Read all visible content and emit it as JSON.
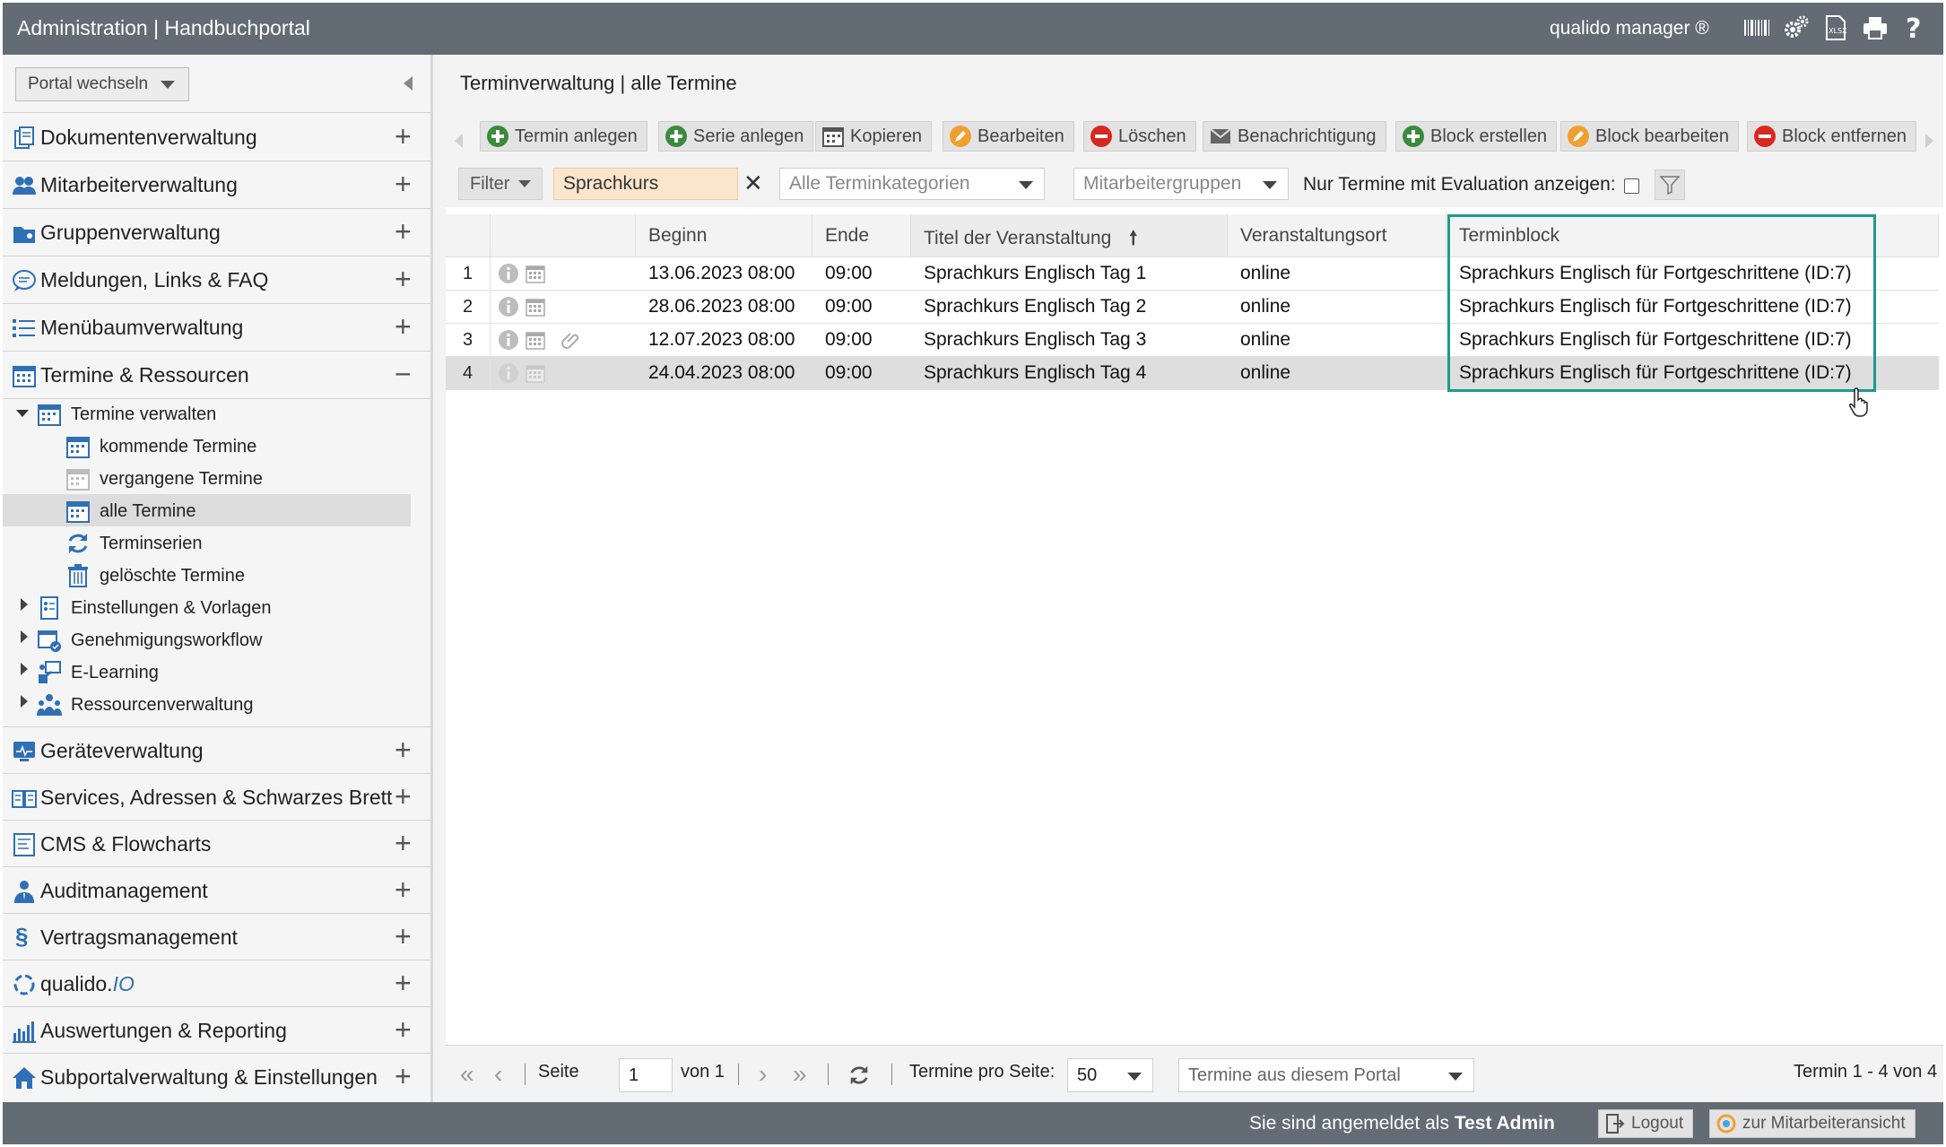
{
  "header": {
    "title": "Administration | Handbuchportal",
    "brand": "qualido manager ®",
    "icons": [
      "barcode-icon",
      "gears-icon",
      "xlsx-export-icon",
      "print-icon",
      "help-icon"
    ]
  },
  "sidebar": {
    "portal_switch": "Portal wechseln",
    "sections": [
      {
        "label": "Dokumentenverwaltung",
        "icon": "documents-icon",
        "state": "+"
      },
      {
        "label": "Mitarbeiterverwaltung",
        "icon": "users-icon",
        "state": "+"
      },
      {
        "label": "Gruppenverwaltung",
        "icon": "group-folder-icon",
        "state": "+"
      },
      {
        "label": "Meldungen, Links & FAQ",
        "icon": "speech-bubble-icon",
        "state": "+"
      },
      {
        "label": "Menübaumverwaltung",
        "icon": "list-tree-icon",
        "state": "+"
      },
      {
        "label": "Termine & Ressourcen",
        "icon": "calendar-icon",
        "state": "−"
      }
    ],
    "tree": {
      "termine_verwalten": "Termine verwalten",
      "kommende": "kommende Termine",
      "vergangene": "vergangene Termine",
      "alle": "alle Termine",
      "serien": "Terminserien",
      "geloescht": "gelöschte Termine",
      "einstellungen": "Einstellungen & Vorlagen",
      "genehmigung": "Genehmigungsworkflow",
      "elearning": "E-Learning",
      "ressourcen": "Ressourcenverwaltung"
    },
    "sections2": [
      {
        "label": "Geräteverwaltung",
        "icon": "device-monitor-icon",
        "state": "+"
      },
      {
        "label": "Services, Adressen & Schwarzes Brett",
        "icon": "address-book-icon",
        "state": "+"
      },
      {
        "label": "CMS & Flowcharts",
        "icon": "cms-icon",
        "state": "+"
      },
      {
        "label": "Auditmanagement",
        "icon": "auditor-icon",
        "state": "+"
      },
      {
        "label": "Vertragsmanagement",
        "icon": "paragraph-icon",
        "state": "+"
      },
      {
        "label": "qualido.",
        "label_suffix": "IO",
        "icon": "qualido-io-icon",
        "state": "+"
      },
      {
        "label": "Auswertungen & Reporting",
        "icon": "bar-chart-icon",
        "state": "+"
      },
      {
        "label": "Subportalverwaltung & Einstellungen",
        "icon": "home-icon",
        "state": "+"
      }
    ]
  },
  "main": {
    "breadcrumb": "Terminverwaltung | alle Termine",
    "toolbar": {
      "termin_anlegen": "Termin anlegen",
      "serie_anlegen": "Serie anlegen",
      "kopieren": "Kopieren",
      "bearbeiten": "Bearbeiten",
      "loeschen": "Löschen",
      "benachrichtigung": "Benachrichtigung",
      "block_erstellen": "Block erstellen",
      "block_bearbeiten": "Block bearbeiten",
      "block_entfernen": "Block entfernen"
    },
    "filter": {
      "filter_label": "Filter",
      "search_value": "Sprachkurs",
      "kategorien": "Alle Terminkategorien",
      "gruppen": "Mitarbeitergruppen",
      "evaluation_label": "Nur Termine mit Evaluation anzeigen:",
      "evaluation_checked": false
    },
    "grid": {
      "columns": [
        "Beginn",
        "Ende",
        "Titel der Veranstaltung",
        "Veranstaltungsort",
        "Terminblock"
      ],
      "sort_indicator": "🠕",
      "rows": [
        {
          "num": "1",
          "beginn": "13.06.2023 08:00",
          "ende": "09:00",
          "titel": "Sprachkurs Englisch Tag 1",
          "ort": "online",
          "block": "Sprachkurs Englisch für Fortgeschrittene (ID:7)",
          "attachment": false,
          "selected": false
        },
        {
          "num": "2",
          "beginn": "28.06.2023 08:00",
          "ende": "09:00",
          "titel": "Sprachkurs Englisch Tag 2",
          "ort": "online",
          "block": "Sprachkurs Englisch für Fortgeschrittene (ID:7)",
          "attachment": false,
          "selected": false
        },
        {
          "num": "3",
          "beginn": "12.07.2023 08:00",
          "ende": "09:00",
          "titel": "Sprachkurs Englisch Tag 3",
          "ort": "online",
          "block": "Sprachkurs Englisch für Fortgeschrittene (ID:7)",
          "attachment": true,
          "selected": false
        },
        {
          "num": "4",
          "beginn": "24.04.2023 08:00",
          "ende": "09:00",
          "titel": "Sprachkurs Englisch Tag 4",
          "ort": "online",
          "block": "Sprachkurs Englisch für Fortgeschrittene (ID:7)",
          "attachment": false,
          "selected": true
        }
      ]
    },
    "pager": {
      "seite_label": "Seite",
      "page_value": "1",
      "von": "von 1",
      "per_page_label": "Termine pro Seite:",
      "per_page_value": "50",
      "portal_scope": "Termine aus diesem Portal",
      "summary": "Termin 1 - 4 von 4"
    }
  },
  "footer": {
    "logged_in_prefix": "Sie sind angemeldet als",
    "user": "Test Admin",
    "logout": "Logout",
    "employee_view": "zur Mitarbeiteransicht"
  },
  "colors": {
    "header_bg": "#636b75",
    "highlight": "#1e9a8c",
    "add_green": "#3b8a3e",
    "edit_orange": "#f0a030",
    "delete_red": "#d9281e",
    "icon_blue": "#2f6fb5",
    "search_bg": "#fce5cd"
  }
}
